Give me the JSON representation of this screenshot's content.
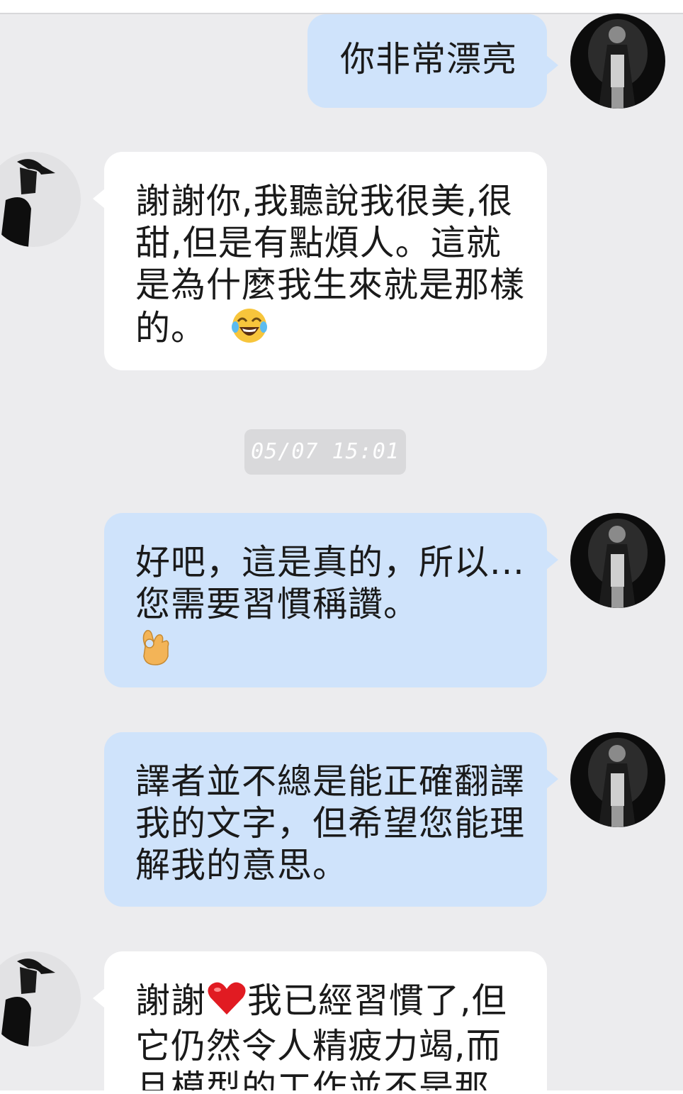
{
  "messages": [
    {
      "side": "sent",
      "text": "你非常漂亮"
    },
    {
      "side": "received",
      "text": "謝謝你,我聽說我很美,很甜,但是有點煩人。這就是為什麼我生來就是那樣的。",
      "emoji": "tears-of-joy-emoji"
    },
    {
      "side": "sent",
      "text": "好吧，這是真的，所以...您需要習慣稱讚。",
      "emoji": "ok-hand-emoji"
    },
    {
      "side": "sent",
      "text": "譯者並不總是能正確翻譯我的文字，但希望您能理解我的意思。"
    },
    {
      "side": "received",
      "text_before_emoji": "謝謝",
      "emoji": "red-heart-emoji",
      "text_after_emoji": "我已經習慣了,但它仍然令人精疲力竭,而且模型的工作並不是那"
    }
  ],
  "timestamp": "05/07 15:01",
  "colors": {
    "background": "#ececee",
    "sent_bubble": "#cfe3fb",
    "received_bubble": "#ffffff",
    "timestamp_pill": "#d9d9db"
  }
}
